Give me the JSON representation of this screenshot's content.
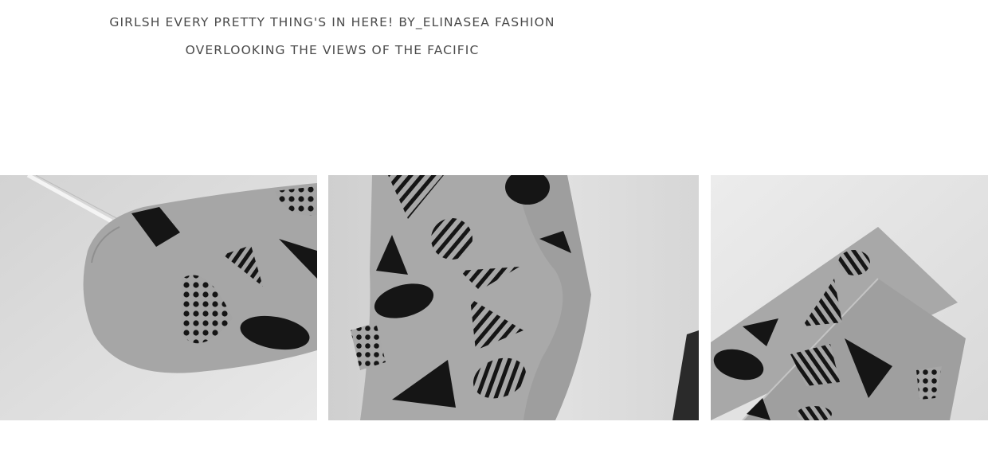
{
  "header": {
    "line1": "GIRLSH EVERY PRETTY THING'S IN HERE! BY_ELINASEA FASHION",
    "line2": "OVERLOOKING THE VIEWS OF THE FACIFIC"
  },
  "gallery": {
    "photos": [
      {
        "subject": "grey sock heel with black geometric pattern"
      },
      {
        "subject": "pair of grey socks with black geometric pattern"
      },
      {
        "subject": "grey socks laid flat with black geometric pattern"
      }
    ]
  },
  "colors": {
    "sock_grey": "#a7a7a7",
    "pattern_black": "#151515",
    "backdrop": "#e4e4e4",
    "text": "#4a4a4a"
  }
}
